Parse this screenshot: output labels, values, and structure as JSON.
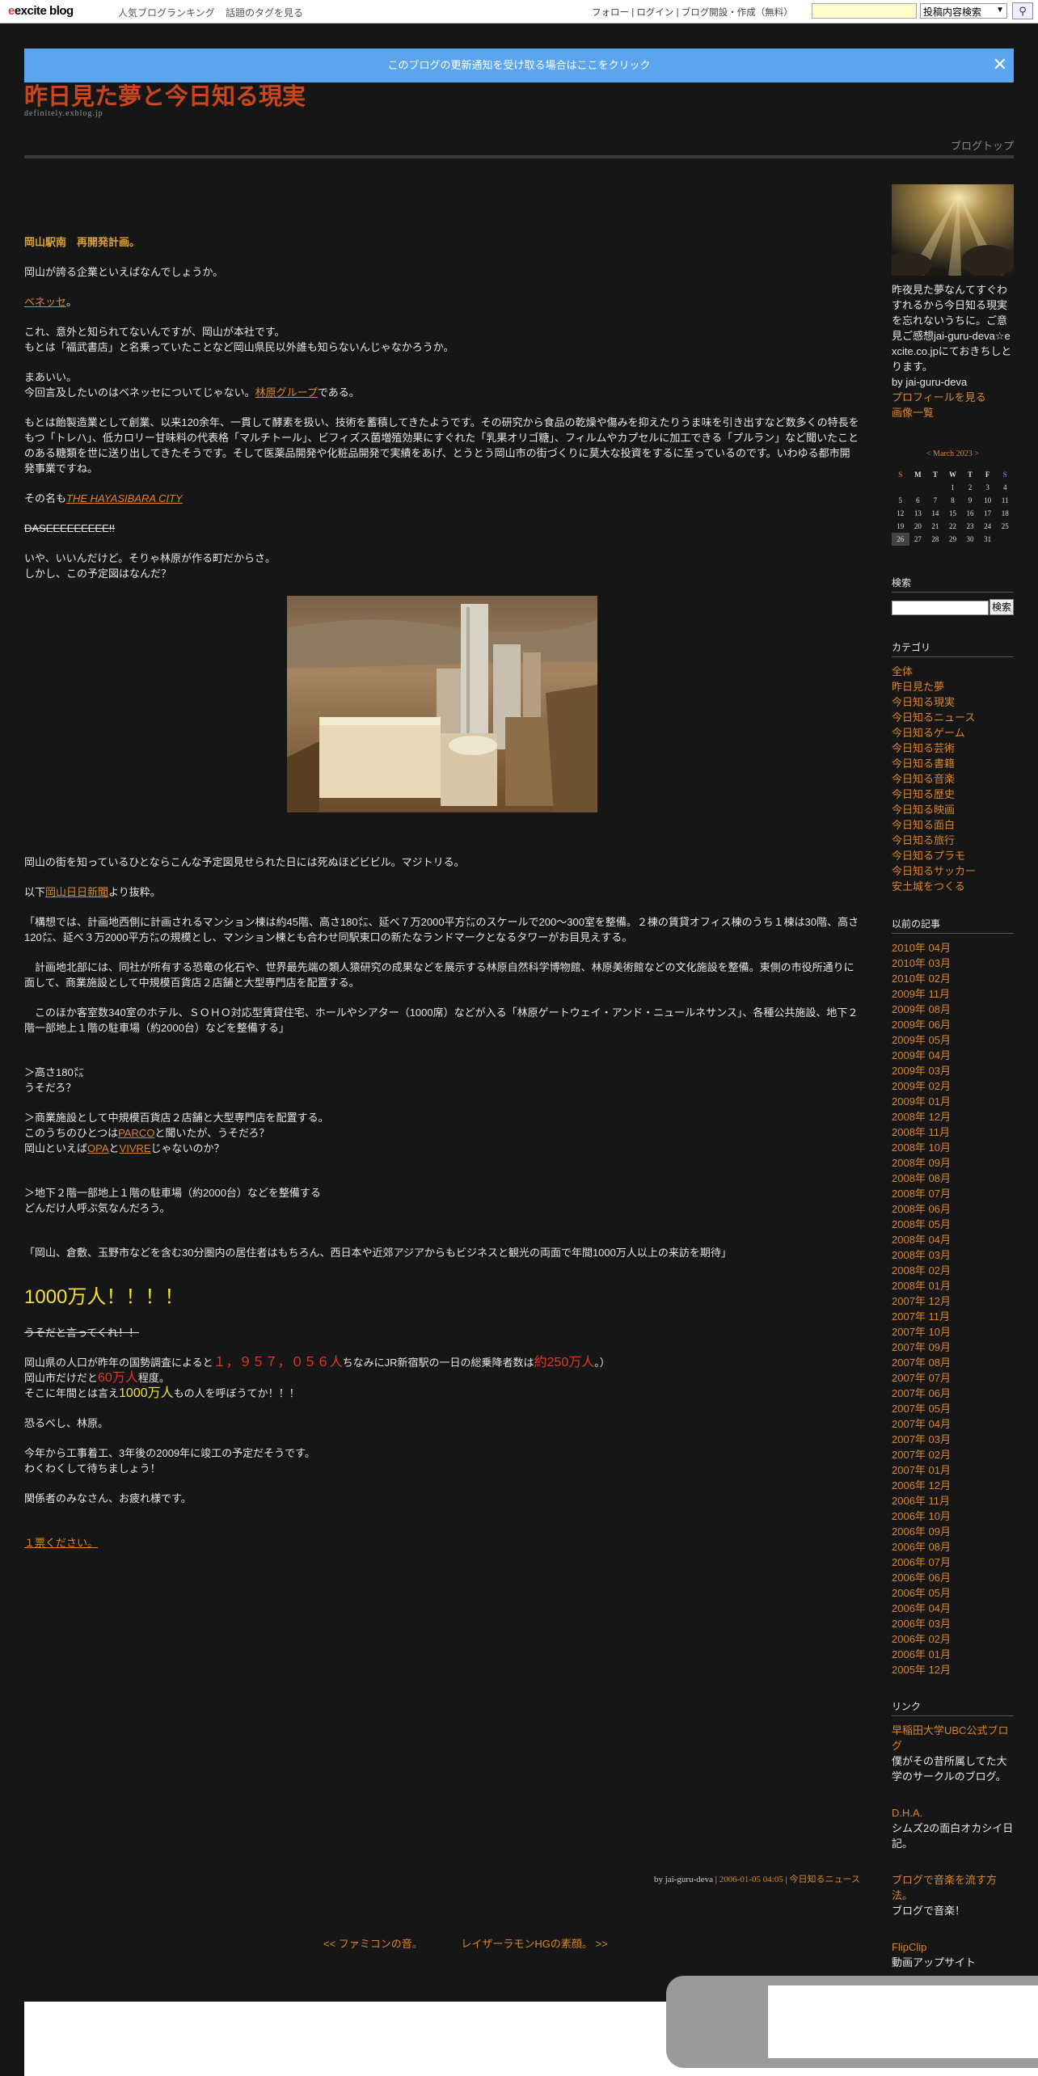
{
  "topbar": {
    "logo": "excite blog",
    "links": [
      "人気ブログランキング",
      "話題のタグを見る"
    ],
    "right_links": "フォロー | ログイン | ブログ開設・作成（無料）",
    "search_placeholder": "",
    "select_value": "投稿内容検索"
  },
  "notice": {
    "text": "このブログの更新通知を受け取る場合はここをクリック"
  },
  "blog": {
    "title": "昨日見た夢と今日知る現実",
    "domain": "definitely.exblog.jp",
    "top_link": "ブログトップ"
  },
  "post": {
    "title": "岡山駅南　再開発計画。",
    "p1": "岡山が誇る企業といえばなんでしょうか。",
    "benesse": "ベネッセ",
    "benesse_tail": "。",
    "p3a": "これ、意外と知られてないんですが、岡山が本社です。",
    "p3b": "もとは「福武書店」と名乗っていたことなど岡山県民以外誰も知らないんじゃなかろうか。",
    "p4a": "まあいい。",
    "p4b_pre": "今回言及したいのはベネッセについてじゃない。",
    "p4b_link": "林原グループ",
    "p4b_post": "である。",
    "p5": "もとは飴製造業として創業、以来120余年、一貫して酵素を扱い、技術を蓄積してきたようです。その研究から食品の乾燥や傷みを抑えたりうま味を引き出すなど数多くの特長をもつ「トレハ」、低カロリー甘味料の代表格「マルチトール」、ビフィズス菌増殖効果にすぐれた「乳果オリゴ糖」、フィルムやカプセルに加工できる「プルラン」など聞いたことのある糖類を世に送り出してきたそうです。そして医薬品開発や化粧品開発で実績をあげ、とうとう岡山市の街づくりに莫大な投資をするに至っているのです。いわゆる都市開発事業ですね。",
    "p6_pre": "その名も",
    "p6_link": "THE HAYASIBARA CITY",
    "p7": "DASEEEEEEEEE!!",
    "p8a": "いや、いいんだけど。そりゃ林原が作る町だからさ。",
    "p8b": "しかし、この予定図はなんだ？",
    "p9": "岡山の街を知っているひとならこんな予定図見せられた日には死ぬほどビビル。マジトリる。",
    "p10_pre": "以下",
    "p10_link": "岡山日日新聞",
    "p10_post": "より抜粋。",
    "q1": "「構想では、計画地西側に計画されるマンション棟は約45階、高さ180㍍、延べ７万2000平方㍍のスケールで200～300室を整備。２棟の賃貸オフィス棟のうち１棟は30階、高さ120㍍、延べ３万2000平方㍍の規模とし、マンション棟とも合わせ同駅東口の新たなランドマークとなるタワーがお目見えする。",
    "q2": "　計画地北部には、同社が所有する恐竜の化石や、世界最先端の類人猿研究の成果などを展示する林原自然科学博物館、林原美術館などの文化施設を整備。東側の市役所通りに面して、商業施設として中規模百貨店２店舗と大型専門店を配置する。",
    "q3": "　このほか客室数340室のホテル、ＳＯＨＯ対応型賃貸住宅、ホールやシアター（1000席）などが入る「林原ゲートウェイ・アンド・ニュールネサンス」、各種公共施設、地下２階一部地上１階の駐車場（約2000台）などを整備する」",
    "c1a": "＞高さ180㍍",
    "c1b": "うそだろ？",
    "c2a": "＞商業施設として中規模百貨店２店舗と大型専門店を配置する。",
    "c2b_pre": "このうちのひとつは",
    "c2b_link": "PARCO",
    "c2b_post": "と聞いたが、うそだろ？",
    "c2c_pre": "岡山といえば",
    "c2c_link1": "OPA",
    "c2c_mid": "と",
    "c2c_link2": "VIVRE",
    "c2c_post": "じゃないのか？",
    "c3a": "＞地下２階一部地上１階の駐車場（約2000台）などを整備する",
    "c3b": "どんだけ人呼ぶ気なんだろう。",
    "q4": "「岡山、倉敷、玉野市などを含む30分圏内の居住者はもちろん、西日本や近郊アジアからもビジネスと観光の両面で年間1000万人以上の来訪を期待」",
    "big": "1000万人！！！！",
    "strike2": "うそだと言ってくれ！！",
    "s1_pre": "岡山県の人口が昨年の国勢調査によると",
    "s1_red": "１，９５７，０５６人",
    "s1_mid": "ちなみにJR新宿駅の一日の総乗降者数は",
    "s1_red2": "約250万人",
    "s1_post": "。）",
    "s2_pre": "岡山市だけだと",
    "s2_red": "60万人",
    "s2_post": "程度。",
    "s3_pre": "そこに年間とは言え",
    "s3_yel": "1000万人",
    "s3_post": "もの人を呼ぼうてか！！！",
    "s4": "恐るべし、林原。",
    "s5a": "今年から工事着工、3年後の2009年に竣工の予定だそうです。",
    "s5b": "わくわくして待ちましょう！",
    "s6": "関係者のみなさん、お疲れ様です。",
    "vote": "１票ください。",
    "footer_by": "by jai-guru-deva",
    "footer_sep": " | ",
    "footer_date": "2006-01-05 04:05",
    "footer_cat": "今日知るニュース"
  },
  "nav": {
    "prev": "<< ファミコンの音。",
    "next": "レイザーラモンHGの素顔。 >>"
  },
  "sidebar": {
    "profile_text": "昨夜見た夢なんてすぐわすれるから今日知る現実を忘れないうちに。ご意見ご感想jai-guru-deva☆excite.co.jpにておきちしとります。",
    "profile_by": "by jai-guru-deva",
    "profile_link": "プロフィールを見る",
    "images_link": "画像一覧",
    "calendar": {
      "title": "< March 2023 >",
      "days": [
        "S",
        "M",
        "T",
        "W",
        "T",
        "F",
        "S"
      ],
      "rows": [
        [
          "",
          "",
          "",
          "1",
          "2",
          "3",
          "4"
        ],
        [
          "5",
          "6",
          "7",
          "8",
          "9",
          "10",
          "11"
        ],
        [
          "12",
          "13",
          "14",
          "15",
          "16",
          "17",
          "18"
        ],
        [
          "19",
          "20",
          "21",
          "22",
          "23",
          "24",
          "25"
        ],
        [
          "26",
          "27",
          "28",
          "29",
          "30",
          "31",
          ""
        ]
      ],
      "today": "26",
      "sunday_color": "#e05a30",
      "saturday_color": "#5a7ae0"
    },
    "search_heading": "検索",
    "search_button": "検索",
    "category_heading": "カテゴリ",
    "categories": [
      "全体",
      "昨日見た夢",
      "今日知る現実",
      "今日知るニュース",
      "今日知るゲーム",
      "今日知る芸術",
      "今日知る書籍",
      "今日知る音楽",
      "今日知る歴史",
      "今日知る映画",
      "今日知る面白",
      "今日知る旅行",
      "今日知るプラモ",
      "今日知るサッカー",
      "安土城をつくる"
    ],
    "archive_heading": "以前の記事",
    "archives": [
      "2010年 04月",
      "2010年 03月",
      "2010年 02月",
      "2009年 11月",
      "2009年 08月",
      "2009年 06月",
      "2009年 05月",
      "2009年 04月",
      "2009年 03月",
      "2009年 02月",
      "2009年 01月",
      "2008年 12月",
      "2008年 11月",
      "2008年 10月",
      "2008年 09月",
      "2008年 08月",
      "2008年 07月",
      "2008年 06月",
      "2008年 05月",
      "2008年 04月",
      "2008年 03月",
      "2008年 02月",
      "2008年 01月",
      "2007年 12月",
      "2007年 11月",
      "2007年 10月",
      "2007年 09月",
      "2007年 08月",
      "2007年 07月",
      "2007年 06月",
      "2007年 05月",
      "2007年 04月",
      "2007年 03月",
      "2007年 02月",
      "2007年 01月",
      "2006年 12月",
      "2006年 11月",
      "2006年 10月",
      "2006年 09月",
      "2006年 08月",
      "2006年 07月",
      "2006年 06月",
      "2006年 05月",
      "2006年 04月",
      "2006年 03月",
      "2006年 02月",
      "2006年 01月",
      "2005年 12月"
    ],
    "links_heading": "リンク",
    "links": [
      {
        "title": "早稲田大学UBC公式ブログ",
        "desc": "僕がその昔所属してた大学のサークルのブログ。"
      },
      {
        "title": "D.H.A.",
        "desc": "シムズ2の面白オカシイ日記。"
      },
      {
        "title": "ブログで音楽を流す方法。",
        "desc": "ブログで音楽！"
      },
      {
        "title": "FlipClip",
        "desc": "動画アップサイト"
      }
    ]
  },
  "colors": {
    "background": "#161616",
    "link": "#d9862b",
    "title": "#c8461f",
    "notice": "#5aa5ee",
    "highlight_red": "#e03a24",
    "highlight_yellow": "#f0e040"
  }
}
